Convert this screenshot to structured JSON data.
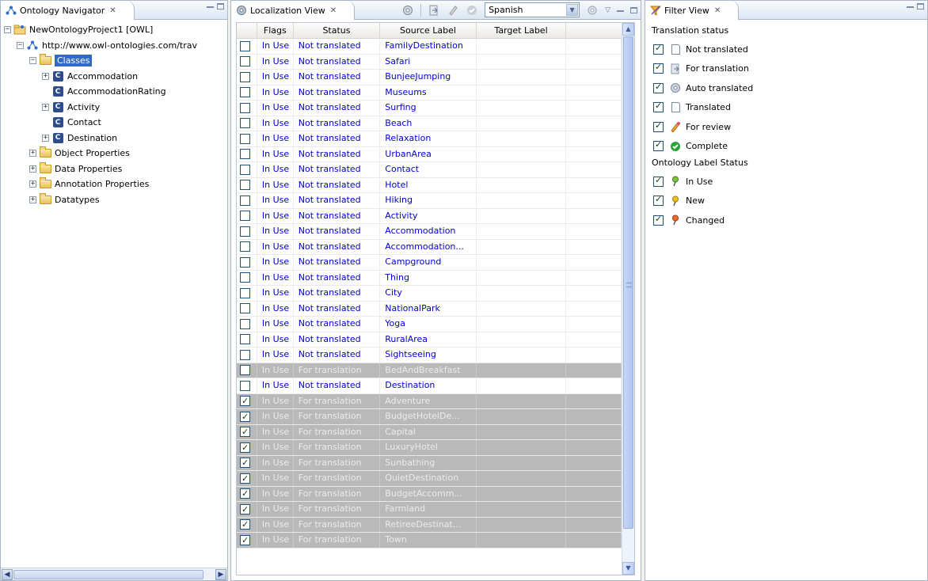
{
  "navigator": {
    "tab_title": "Ontology Navigator",
    "close_glyph": "✕",
    "tree": [
      {
        "label": "NewOntologyProject1 [OWL]",
        "level": 0,
        "icon": "project-icon",
        "expander": "-"
      },
      {
        "label": "http://www.owl-ontologies.com/trav",
        "level": 1,
        "icon": "ontology-icon",
        "expander": "-"
      },
      {
        "label": "Classes",
        "level": 2,
        "icon": "folder-icon",
        "expander": "-",
        "selected": true
      },
      {
        "label": "Accommodation",
        "level": 3,
        "icon": "class-icon",
        "expander": "+"
      },
      {
        "label": "AccommodationRating",
        "level": 3,
        "icon": "class-icon",
        "expander": ""
      },
      {
        "label": "Activity",
        "level": 3,
        "icon": "class-icon",
        "expander": "+"
      },
      {
        "label": "Contact",
        "level": 3,
        "icon": "class-icon",
        "expander": ""
      },
      {
        "label": "Destination",
        "level": 3,
        "icon": "class-icon",
        "expander": "+"
      },
      {
        "label": "Object Properties",
        "level": 2,
        "icon": "folder-icon",
        "expander": "+"
      },
      {
        "label": "Data Properties",
        "level": 2,
        "icon": "folder-icon",
        "expander": "+"
      },
      {
        "label": "Annotation Properties",
        "level": 2,
        "icon": "folder-icon",
        "expander": "+"
      },
      {
        "label": "Datatypes",
        "level": 2,
        "icon": "folder-icon",
        "expander": "+"
      }
    ]
  },
  "localization": {
    "tab_title": "Localization View",
    "close_glyph": "✕",
    "language": "Spanish",
    "columns": [
      "Flags",
      "Status",
      "Source Label",
      "Target Label"
    ],
    "rows": [
      {
        "checked": false,
        "flags": "In Use",
        "status": "Not translated",
        "source": "FamilyDestination",
        "target": "",
        "grey": false
      },
      {
        "checked": false,
        "flags": "In Use",
        "status": "Not translated",
        "source": "Safari",
        "target": "",
        "grey": false
      },
      {
        "checked": false,
        "flags": "In Use",
        "status": "Not translated",
        "source": "BunjeeJumping",
        "target": "",
        "grey": false
      },
      {
        "checked": false,
        "flags": "In Use",
        "status": "Not translated",
        "source": "Museums",
        "target": "",
        "grey": false
      },
      {
        "checked": false,
        "flags": "In Use",
        "status": "Not translated",
        "source": "Surfing",
        "target": "",
        "grey": false
      },
      {
        "checked": false,
        "flags": "In Use",
        "status": "Not translated",
        "source": "Beach",
        "target": "",
        "grey": false
      },
      {
        "checked": false,
        "flags": "In Use",
        "status": "Not translated",
        "source": "Relaxation",
        "target": "",
        "grey": false
      },
      {
        "checked": false,
        "flags": "In Use",
        "status": "Not translated",
        "source": "UrbanArea",
        "target": "",
        "grey": false
      },
      {
        "checked": false,
        "flags": "In Use",
        "status": "Not translated",
        "source": "Contact",
        "target": "",
        "grey": false
      },
      {
        "checked": false,
        "flags": "In Use",
        "status": "Not translated",
        "source": "Hotel",
        "target": "",
        "grey": false
      },
      {
        "checked": false,
        "flags": "In Use",
        "status": "Not translated",
        "source": "Hiking",
        "target": "",
        "grey": false
      },
      {
        "checked": false,
        "flags": "In Use",
        "status": "Not translated",
        "source": "Activity",
        "target": "",
        "grey": false
      },
      {
        "checked": false,
        "flags": "In Use",
        "status": "Not translated",
        "source": "Accommodation",
        "target": "",
        "grey": false
      },
      {
        "checked": false,
        "flags": "In Use",
        "status": "Not translated",
        "source": "Accommodation...",
        "target": "",
        "grey": false
      },
      {
        "checked": false,
        "flags": "In Use",
        "status": "Not translated",
        "source": "Campground",
        "target": "",
        "grey": false
      },
      {
        "checked": false,
        "flags": "In Use",
        "status": "Not translated",
        "source": "Thing",
        "target": "",
        "grey": false
      },
      {
        "checked": false,
        "flags": "In Use",
        "status": "Not translated",
        "source": "City",
        "target": "",
        "grey": false
      },
      {
        "checked": false,
        "flags": "In Use",
        "status": "Not translated",
        "source": "NationalPark",
        "target": "",
        "grey": false
      },
      {
        "checked": false,
        "flags": "In Use",
        "status": "Not translated",
        "source": "Yoga",
        "target": "",
        "grey": false
      },
      {
        "checked": false,
        "flags": "In Use",
        "status": "Not translated",
        "source": "RuralArea",
        "target": "",
        "grey": false
      },
      {
        "checked": false,
        "flags": "In Use",
        "status": "Not translated",
        "source": "Sightseeing",
        "target": "",
        "grey": false
      },
      {
        "checked": false,
        "flags": "In Use",
        "status": "For translation",
        "source": "BedAndBreakfast",
        "target": "",
        "grey": true
      },
      {
        "checked": false,
        "flags": "In Use",
        "status": "Not translated",
        "source": "Destination",
        "target": "",
        "grey": false
      },
      {
        "checked": true,
        "flags": "In Use",
        "status": "For translation",
        "source": "Adventure",
        "target": "",
        "grey": true
      },
      {
        "checked": true,
        "flags": "In Use",
        "status": "For translation",
        "source": "BudgetHotelDe...",
        "target": "",
        "grey": true
      },
      {
        "checked": true,
        "flags": "In Use",
        "status": "For translation",
        "source": "Capital",
        "target": "",
        "grey": true
      },
      {
        "checked": true,
        "flags": "In Use",
        "status": "For translation",
        "source": "LuxuryHotel",
        "target": "",
        "grey": true
      },
      {
        "checked": true,
        "flags": "In Use",
        "status": "For translation",
        "source": "Sunbathing",
        "target": "",
        "grey": true
      },
      {
        "checked": true,
        "flags": "In Use",
        "status": "For translation",
        "source": "QuietDestination",
        "target": "",
        "grey": true
      },
      {
        "checked": true,
        "flags": "In Use",
        "status": "For translation",
        "source": "BudgetAccomm...",
        "target": "",
        "grey": true
      },
      {
        "checked": true,
        "flags": "In Use",
        "status": "For translation",
        "source": "Farmland",
        "target": "",
        "grey": true
      },
      {
        "checked": true,
        "flags": "In Use",
        "status": "For translation",
        "source": "RetireeDestinat...",
        "target": "",
        "grey": true
      },
      {
        "checked": true,
        "flags": "In Use",
        "status": "For translation",
        "source": "Town",
        "target": "",
        "grey": true
      }
    ]
  },
  "filter": {
    "tab_title": "Filter View",
    "close_glyph": "✕",
    "translation_heading": "Translation status",
    "translation_items": [
      {
        "label": "Not translated",
        "icon": "document-icon"
      },
      {
        "label": "For translation",
        "icon": "for-translation-icon"
      },
      {
        "label": "Auto translated",
        "icon": "gear-icon"
      },
      {
        "label": "Translated",
        "icon": "document-icon"
      },
      {
        "label": "For review",
        "icon": "pencil-icon"
      },
      {
        "label": "Complete",
        "icon": "checkmark-icon"
      }
    ],
    "label_heading": "Ontology Label Status",
    "label_items": [
      {
        "label": "In Use",
        "icon": "pin-green-icon"
      },
      {
        "label": "New",
        "icon": "pin-yellow-icon"
      },
      {
        "label": "Changed",
        "icon": "pin-red-icon"
      }
    ]
  },
  "colors": {
    "link_text": "#0000d0",
    "grey_row": "#b9b9b9",
    "selection": "#316ac5"
  }
}
